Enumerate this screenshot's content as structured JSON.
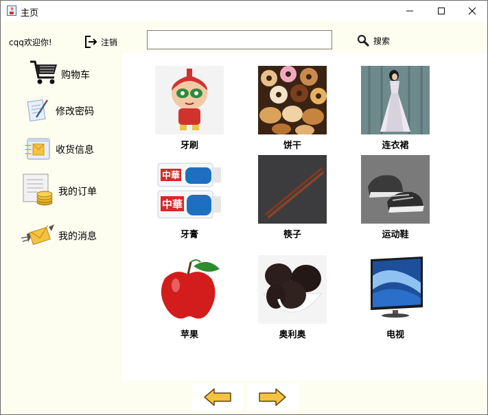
{
  "window": {
    "title": "主页",
    "app_icon": "java-cup-icon",
    "controls": [
      "minimize-icon",
      "maximize-icon",
      "close-icon"
    ]
  },
  "sidebar": {
    "welcome": "cqq欢迎你!",
    "logout_label": "注销",
    "items": [
      {
        "label": "购物车",
        "icon": "shopping-cart-icon"
      },
      {
        "label": "修改密码",
        "icon": "document-pen-icon"
      },
      {
        "label": "收货信息",
        "icon": "envelope-list-icon"
      },
      {
        "label": "我的订单",
        "icon": "receipt-coins-icon"
      },
      {
        "label": "我的消息",
        "icon": "flying-envelope-icon"
      }
    ]
  },
  "search": {
    "value": "",
    "placeholder": "",
    "button_label": "搜索"
  },
  "products": [
    {
      "name": "牙刷"
    },
    {
      "name": "饼干"
    },
    {
      "name": "连衣裙"
    },
    {
      "name": "牙膏"
    },
    {
      "name": "筷子"
    },
    {
      "name": "运动鞋"
    },
    {
      "name": "苹果"
    },
    {
      "name": "奥利奥"
    },
    {
      "name": "电视"
    }
  ],
  "toothpaste_brand": "中華",
  "pager": {
    "prev_icon": "arrow-left-icon",
    "next_icon": "arrow-right-icon"
  },
  "colors": {
    "panel_bg": "#fdfdf0",
    "content_bg": "#ffffff",
    "arrow_fill": "#f5c242"
  }
}
